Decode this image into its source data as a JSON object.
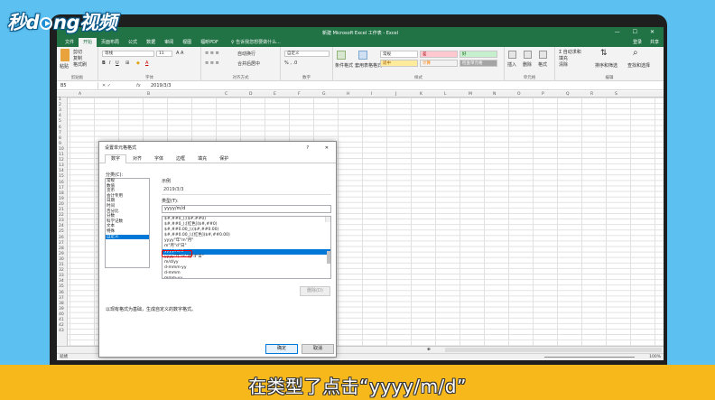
{
  "logo": {
    "text_a": "秒d",
    "text_b": "ng视频"
  },
  "titlebar": {
    "title": "新建 Microsoft Excel 工作表 - Excel",
    "controls": "— ☐ ✕"
  },
  "menubar": {
    "tabs": [
      "文件",
      "开始",
      "页面布局",
      "公式",
      "数据",
      "审阅",
      "视图",
      "福昕PDF"
    ],
    "tell_me": "♀ 告诉我您想要做什么...",
    "login": "登录",
    "share": "共享"
  },
  "ribbon": {
    "clipboard": {
      "name": "剪贴板",
      "paste": "粘贴",
      "cut": "剪切",
      "copy": "复制",
      "format_painter": "格式刷"
    },
    "font": {
      "name": "字体",
      "font_name": "等线",
      "font_size": "11"
    },
    "align": {
      "name": "对齐方式",
      "wrap": "自动换行",
      "merge": "合并后居中"
    },
    "number": {
      "name": "数字",
      "format": "自定义"
    },
    "styles": {
      "name": "样式",
      "cond": "条件格式",
      "table": "套用表格格式",
      "normal": "常规",
      "bad": "差",
      "good": "好",
      "neutral": "适中",
      "calc": "计算",
      "check": "检查单元格"
    },
    "cells": {
      "name": "单元格",
      "insert": "插入",
      "delete": "删除",
      "format": "格式"
    },
    "edit": {
      "name": "编辑",
      "autosum": "自动求和",
      "fill": "填充",
      "clear": "清除",
      "sort": "排序和筛选",
      "find": "查找和选择"
    }
  },
  "formulabar": {
    "namebox": "B5",
    "fx": "fx",
    "value": "2019/3/3"
  },
  "grid": {
    "columns": [
      "A",
      "B",
      "C",
      "D",
      "E",
      "F",
      "G",
      "H",
      "I",
      "J",
      "K",
      "L",
      "M",
      "N",
      "O",
      "P",
      "Q",
      "R",
      "S"
    ],
    "rows": [
      "1",
      "2",
      "3",
      "4",
      "5",
      "6",
      "7",
      "8",
      "9",
      "10",
      "11",
      "12",
      "13",
      "14",
      "15",
      "16",
      "17",
      "18",
      "19",
      "20",
      "21",
      "22",
      "23",
      "24",
      "25",
      "26",
      "27",
      "28",
      "29",
      "30",
      "31",
      "32",
      "33",
      "34",
      "35",
      "36",
      "37",
      "38",
      "39",
      "40",
      "41",
      "42",
      "43"
    ]
  },
  "sheetbar": {
    "status": "就绪",
    "zoom": "100%"
  },
  "dialog": {
    "title": "设置单元格格式",
    "help": "?",
    "close": "✕",
    "tabs": [
      "数字",
      "对齐",
      "字体",
      "边框",
      "填充",
      "保护"
    ],
    "category_label": "分类(C):",
    "categories": [
      "常规",
      "数值",
      "货币",
      "会计专用",
      "日期",
      "时间",
      "百分比",
      "分数",
      "科学记数",
      "文本",
      "特殊",
      "自定义"
    ],
    "sample_label": "示例",
    "sample_value": "2019/3/3",
    "type_label": "类型(T):",
    "type_value": "yyyy/m/d",
    "formats": [
      "$#,##0_);($#,##0)",
      "$#,##0_);[红色]($#,##0)",
      "$#,##0.00_);($#,##0.00)",
      "$#,##0.00_);[红色]($#,##0.00)",
      "yyyy\"年\"m\"月\"",
      "m\"月\"d\"日\"",
      "yyyy/m/d",
      "yyyy\"年\"m\"月\"d\"日\"",
      "m/d/yy",
      "d-mmm-yy",
      "d-mmm",
      "mmm-yy"
    ],
    "selected_format_index": 6,
    "delete_btn": "删除(D)",
    "description": "以现有格式为基础，生成自定义的数字格式。",
    "ok": "确定",
    "cancel": "取消"
  },
  "caption": "在类型了点击“yyyy/m/d”",
  "colors": {
    "excel_green": "#217346",
    "bg_blue": "#5cc0f0",
    "caption_bar": "#f7b81c",
    "highlight": "#0078d7",
    "red_box": "#ee0000"
  }
}
